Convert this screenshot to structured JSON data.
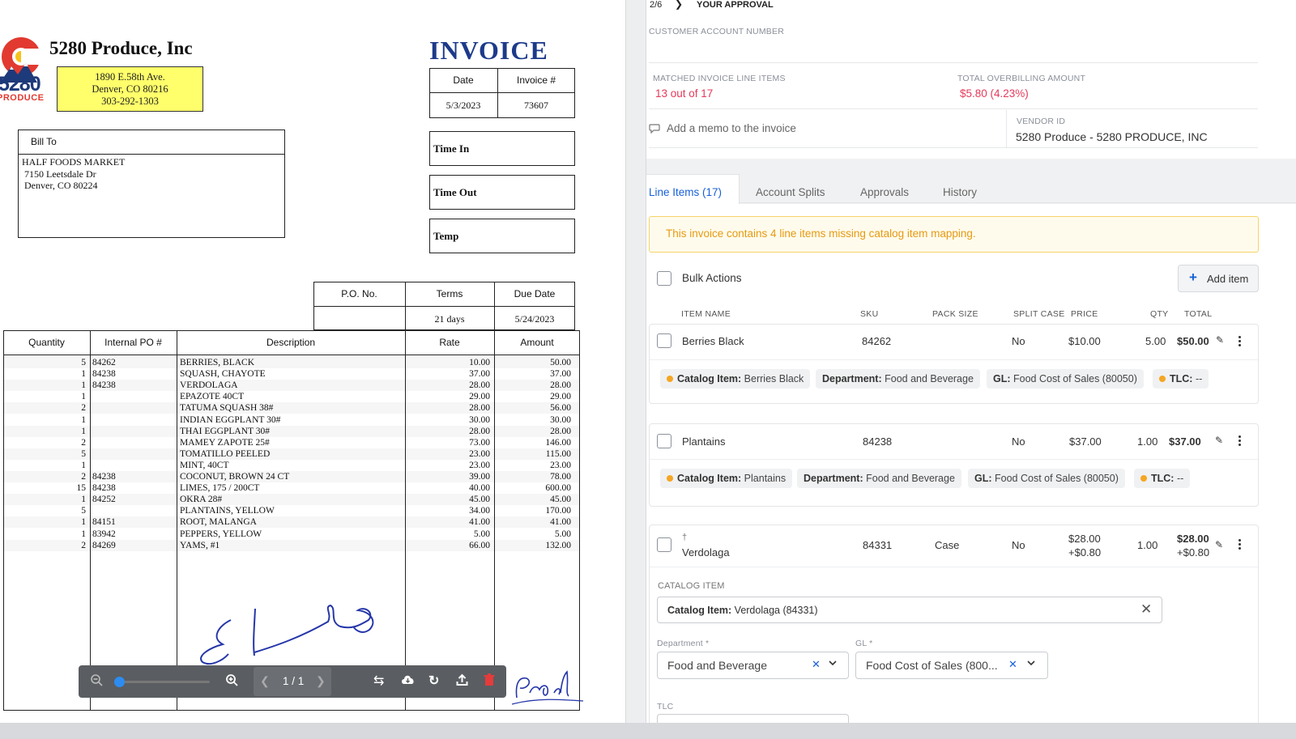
{
  "invoice_doc": {
    "company_name": "5280 Produce, Inc",
    "logo_text": "5280",
    "logo_sub": "PRODUCE",
    "address_lines": [
      "1890 E.58th Ave.",
      "Denver, CO 80216",
      "303-292-1303"
    ],
    "title": "INVOICE",
    "date_label": "Date",
    "date_value": "5/3/2023",
    "invoice_no_label": "Invoice #",
    "invoice_no_value": "73607",
    "bill_to_label": "Bill To",
    "bill_to_lines": [
      "HALF FOODS MARKET",
      "7150 Leetsdale Dr",
      "Denver, CO 80224"
    ],
    "time_in": "Time In",
    "time_out": "Time Out",
    "temp": "Temp",
    "po_label": "P.O. No.",
    "terms_label": "Terms",
    "terms_value": "21 days",
    "due_label": "Due Date",
    "due_value": "5/24/2023",
    "col_quantity": "Quantity",
    "col_po": "Internal PO #",
    "col_description": "Description",
    "col_rate": "Rate",
    "col_amount": "Amount",
    "lines": [
      {
        "qty": "5",
        "po": "84262",
        "desc": "BERRIES, BLACK",
        "rate": "10.00",
        "amount": "50.00"
      },
      {
        "qty": "1",
        "po": "84238",
        "desc": "SQUASH, CHAYOTE",
        "rate": "37.00",
        "amount": "37.00"
      },
      {
        "qty": "1",
        "po": "84238",
        "desc": "VERDOLAGA",
        "rate": "28.00",
        "amount": "28.00"
      },
      {
        "qty": "1",
        "po": "",
        "desc": "EPAZOTE 40CT",
        "rate": "29.00",
        "amount": "29.00"
      },
      {
        "qty": "2",
        "po": "",
        "desc": "TATUMA SQUASH 38#",
        "rate": "28.00",
        "amount": "56.00"
      },
      {
        "qty": "1",
        "po": "",
        "desc": "INDIAN EGGPLANT 30#",
        "rate": "30.00",
        "amount": "30.00"
      },
      {
        "qty": "1",
        "po": "",
        "desc": "THAI EGGPLANT 30#",
        "rate": "28.00",
        "amount": "28.00"
      },
      {
        "qty": "2",
        "po": "",
        "desc": "MAMEY ZAPOTE 25#",
        "rate": "73.00",
        "amount": "146.00"
      },
      {
        "qty": "5",
        "po": "",
        "desc": "TOMATILLO PEELED",
        "rate": "23.00",
        "amount": "115.00"
      },
      {
        "qty": "1",
        "po": "",
        "desc": "MINT, 40CT",
        "rate": "23.00",
        "amount": "23.00"
      },
      {
        "qty": "2",
        "po": "84238",
        "desc": "COCONUT, BROWN 24 CT",
        "rate": "39.00",
        "amount": "78.00"
      },
      {
        "qty": "15",
        "po": "84238",
        "desc": "LIMES, 175 / 200CT",
        "rate": "40.00",
        "amount": "600.00"
      },
      {
        "qty": "1",
        "po": "84252",
        "desc": "OKRA 28#",
        "rate": "45.00",
        "amount": "45.00"
      },
      {
        "qty": "5",
        "po": "",
        "desc": "PLANTAINS, YELLOW",
        "rate": "34.00",
        "amount": "170.00"
      },
      {
        "qty": "1",
        "po": "84151",
        "desc": "ROOT, MALANGA",
        "rate": "41.00",
        "amount": "41.00"
      },
      {
        "qty": "1",
        "po": "83942",
        "desc": "PEPPERS, YELLOW",
        "rate": "5.00",
        "amount": "5.00"
      },
      {
        "qty": "2",
        "po": "84269",
        "desc": "YAMS, #1",
        "rate": "66.00",
        "amount": "132.00"
      }
    ]
  },
  "viewer_toolbar": {
    "page_indicator": "1 / 1",
    "zoom_level": 0.0
  },
  "panel": {
    "pager": "2/6",
    "approval_label": "YOUR APPROVAL",
    "customer_account_label": "CUSTOMER ACCOUNT NUMBER",
    "matched_label": "MATCHED INVOICE LINE ITEMS",
    "matched_value": "13 out of 17",
    "overbilling_label": "TOTAL OVERBILLING AMOUNT",
    "overbilling_value": "$5.80 (4.23%)",
    "memo_placeholder": "Add a memo to the invoice",
    "vendor_label": "VENDOR ID",
    "vendor_value": "5280 Produce - 5280 PRODUCE, INC",
    "tabs": [
      "Line Items (17)",
      "Account Splits",
      "Approvals",
      "History"
    ],
    "warning": "This invoice contains 4 line items missing catalog item mapping.",
    "bulk_actions": "Bulk Actions",
    "add_item": "Add item",
    "headers": {
      "item": "ITEM NAME",
      "sku": "SKU",
      "pack": "PACK SIZE",
      "split": "SPLIT CASE",
      "price": "PRICE",
      "qty": "QTY",
      "total": "TOTAL"
    },
    "items": [
      {
        "name": "Berries Black",
        "sku": "84262",
        "pack": "",
        "split": "No",
        "price": "$10.00",
        "qty": "5.00",
        "total": "$50.00",
        "chips": {
          "catalog_key": "Catalog Item:",
          "catalog_val": "Berries Black",
          "dept_key": "Department:",
          "dept_val": "Food and Beverage",
          "gl_key": "GL:",
          "gl_val": "Food Cost of Sales (80050)",
          "tlc_key": "TLC:",
          "tlc_val": "--"
        }
      },
      {
        "name": "Plantains",
        "sku": "84238",
        "pack": "",
        "split": "No",
        "price": "$37.00",
        "qty": "1.00",
        "total": "$37.00",
        "chips": {
          "catalog_key": "Catalog Item:",
          "catalog_val": "Plantains",
          "dept_key": "Department:",
          "dept_val": "Food and Beverage",
          "gl_key": "GL:",
          "gl_val": "Food Cost of Sales (80050)",
          "tlc_key": "TLC:",
          "tlc_val": "--"
        }
      },
      {
        "name": "Verdolaga",
        "sku": "84331",
        "pack": "Case",
        "split": "No",
        "price": "$28.00",
        "price_diff": "+$0.80",
        "qty": "1.00",
        "total": "$28.00",
        "total_diff": "+$0.80"
      }
    ],
    "edit": {
      "catalog_label": "CATALOG ITEM",
      "catalog_key": "Catalog Item:",
      "catalog_val": "Verdolaga (84331)",
      "dept_label": "Department *",
      "dept_value": "Food and Beverage",
      "gl_label": "GL *",
      "gl_value": "Food Cost of Sales (800...",
      "tlc_label": "TLC"
    }
  }
}
